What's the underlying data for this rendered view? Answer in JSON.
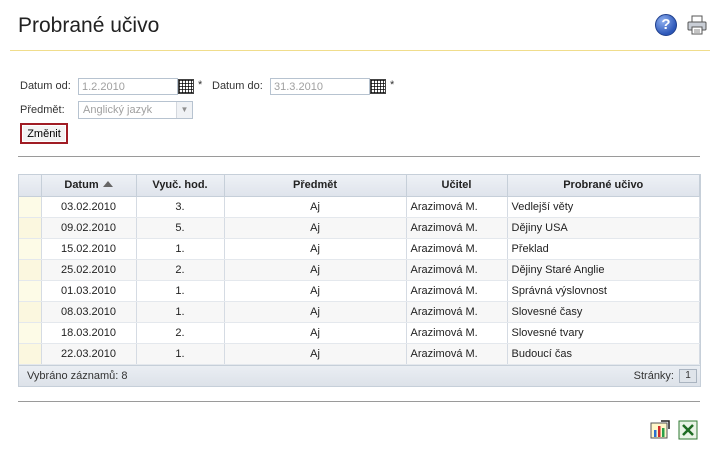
{
  "header": {
    "title": "Probrané učivo",
    "help_glyph": "?"
  },
  "filters": {
    "date_from_label": "Datum od:",
    "date_from_value": "1.2.2010",
    "date_to_label": "Datum do:",
    "date_to_value": "31.3.2010",
    "required_mark": "*",
    "subject_label": "Předmět:",
    "subject_value": "Anglický jazyk",
    "change_button": "Změnit"
  },
  "table": {
    "columns": [
      "Datum",
      "Vyuč. hod.",
      "Předmět",
      "Učitel",
      "Probrané učivo"
    ],
    "sort_column": "Datum",
    "rows": [
      [
        "03.02.2010",
        "3.",
        "Aj",
        "Arazimová M.",
        "Vedlejší věty"
      ],
      [
        "09.02.2010",
        "5.",
        "Aj",
        "Arazimová M.",
        "Dějiny USA"
      ],
      [
        "15.02.2010",
        "1.",
        "Aj",
        "Arazimová M.",
        "Překlad"
      ],
      [
        "25.02.2010",
        "2.",
        "Aj",
        "Arazimová M.",
        "Dějiny Staré Anglie"
      ],
      [
        "01.03.2010",
        "1.",
        "Aj",
        "Arazimová M.",
        "Správná výslovnost"
      ],
      [
        "08.03.2010",
        "1.",
        "Aj",
        "Arazimová M.",
        "Slovesné časy"
      ],
      [
        "18.03.2010",
        "2.",
        "Aj",
        "Arazimová M.",
        "Slovesné tvary"
      ],
      [
        "22.03.2010",
        "1.",
        "Aj",
        "Arazimová M.",
        "Budoucí čas"
      ]
    ],
    "footer_count": "Vybráno záznamů: 8",
    "footer_pages_label": "Stránky:",
    "current_page": "1"
  },
  "icons": {
    "help": "help-icon",
    "print": "printer-icon",
    "calendar": "calendar-icon",
    "export_chart": "chart-export-icon",
    "export_excel": "excel-export-icon"
  },
  "colors": {
    "title_underline": "#f0dd8c",
    "button_border": "#a01c24",
    "grid_header": "#dfe4ec"
  }
}
